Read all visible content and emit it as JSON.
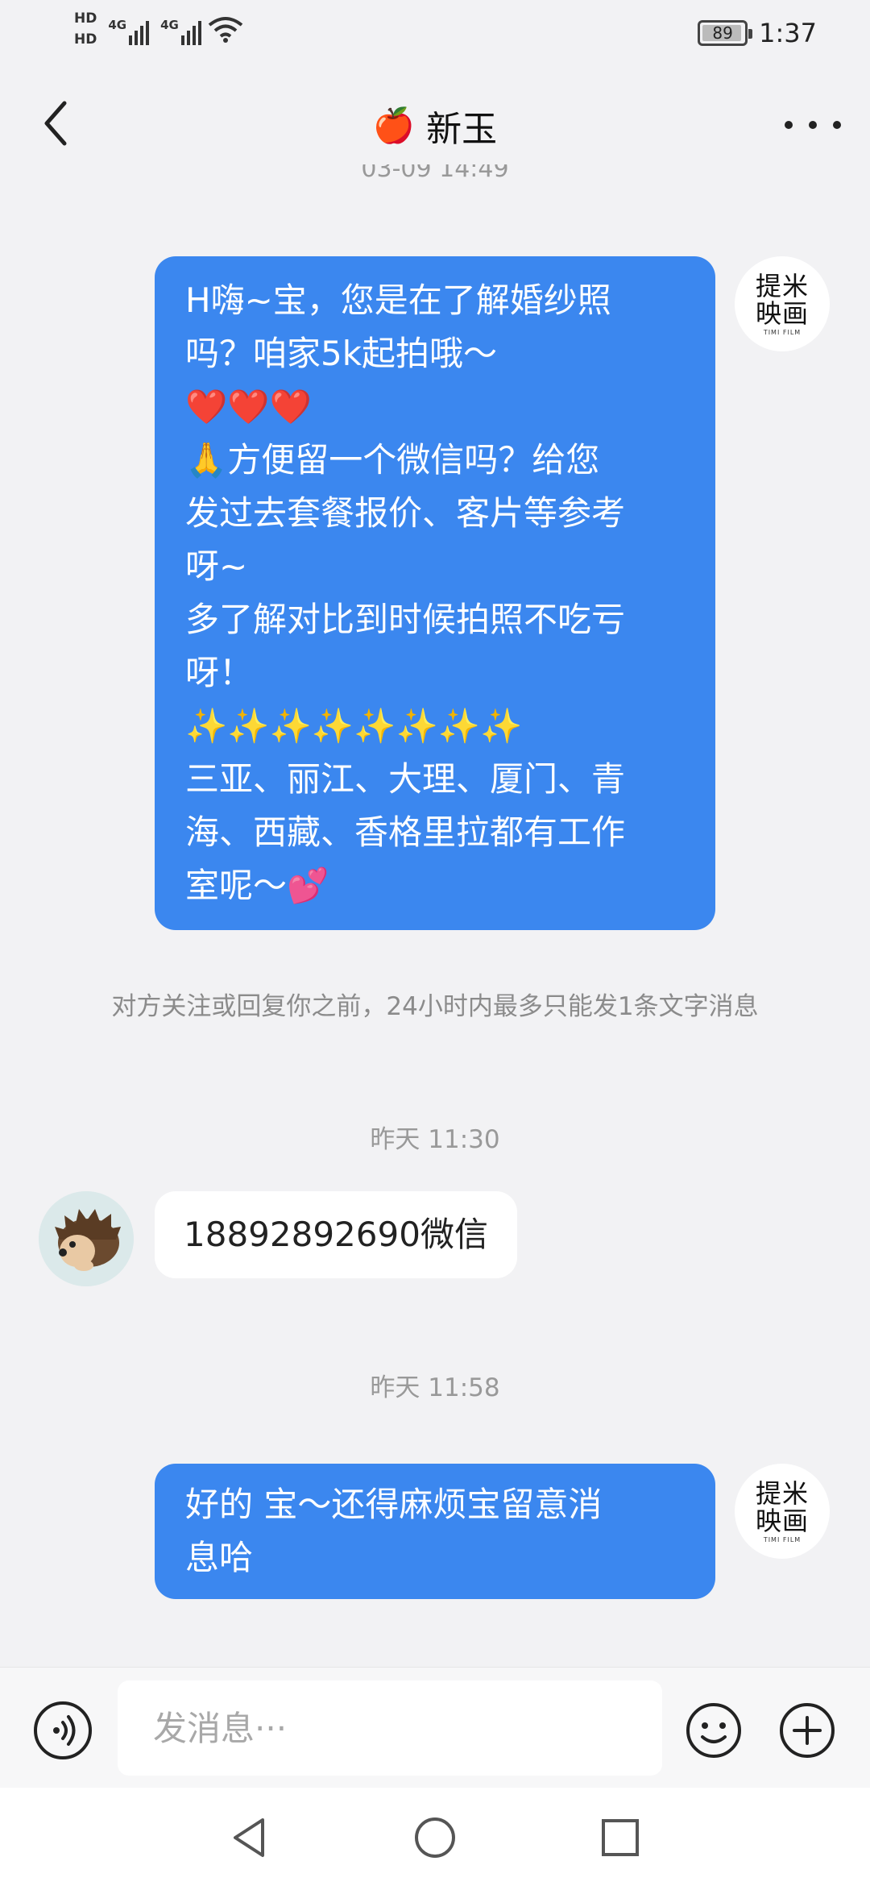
{
  "status_bar": {
    "sim1": "HD",
    "sim2": "HD",
    "net1": "4G",
    "net2": "4G",
    "battery": "89",
    "time": "1:37"
  },
  "header": {
    "title_emoji": "🍎",
    "title": "新玉"
  },
  "partial_timestamp": "03-09 14:49",
  "brand_avatar": {
    "name_line1": "提米",
    "name_line2": "映画",
    "sub": "TIMI FILM"
  },
  "messages": {
    "m1_lines": [
      "H嗨~宝，您是在了解婚纱照",
      "吗？咱家5k起拍哦～",
      "❤️❤️❤️",
      "🙏方便留一个微信吗？给您",
      "发过去套餐报价、客片等参考",
      "呀~",
      "多了解对比到时候拍照不吃亏",
      "呀！",
      "✨✨✨✨✨✨✨✨",
      "三亚、丽江、大理、厦门、青",
      "海、西藏、香格里拉都有工作",
      "室呢～💕"
    ],
    "notice": "对方关注或回复你之前，24小时内最多只能发1条文字消息",
    "ts1": "昨天 11:30",
    "m2": "18892892690微信",
    "ts2": "昨天 11:58",
    "m3_line1": "好的 宝～还得麻烦宝留意消",
    "m3_line2": "息哈"
  },
  "input": {
    "placeholder": "发消息···"
  },
  "icons": {
    "back": "back-arrow-icon",
    "more": "more-dots-icon",
    "voice": "voice-icon",
    "emoji": "emoji-icon",
    "plus": "plus-icon",
    "nav_back": "triangle-back-icon",
    "nav_home": "circle-home-icon",
    "nav_recent": "square-recent-icon"
  },
  "colors": {
    "outgoing_bubble": "#3b87ef",
    "background": "#f2f2f4"
  }
}
